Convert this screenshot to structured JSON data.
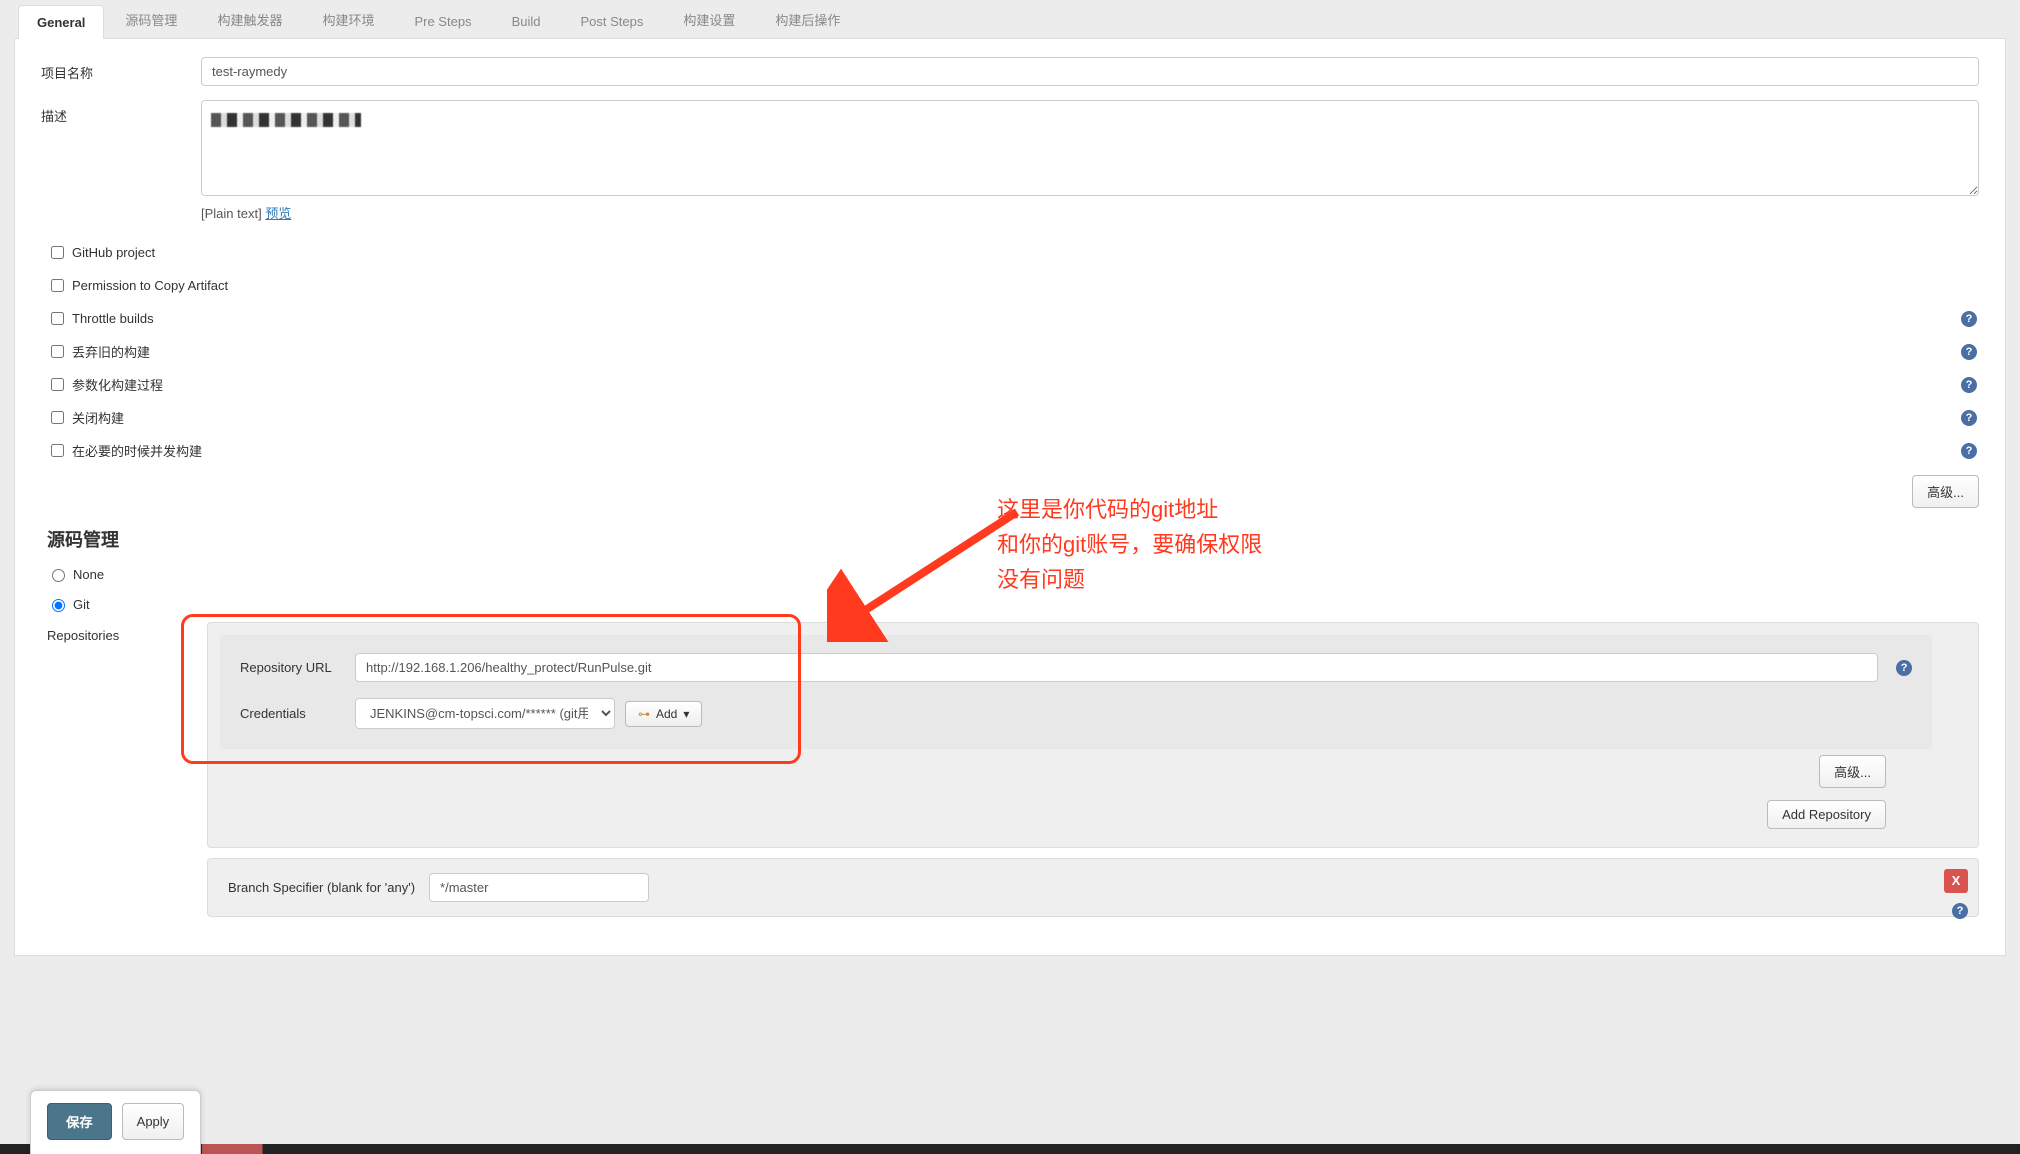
{
  "tabs": {
    "general": "General",
    "scm": "源码管理",
    "triggers": "构建触发器",
    "env": "构建环境",
    "pre": "Pre Steps",
    "build": "Build",
    "post": "Post Steps",
    "settings": "构建设置",
    "postops": "构建后操作"
  },
  "general": {
    "project_name_label": "项目名称",
    "project_name_value": "test-raymedy",
    "description_label": "描述",
    "plain_prefix": "[Plain text] ",
    "preview_link": "预览",
    "checks": {
      "github_project": "GitHub project",
      "permission_copy": "Permission to Copy Artifact",
      "throttle": "Throttle builds",
      "discard_old": "丢弃旧的构建",
      "parameterized": "参数化构建过程",
      "disable": "关闭构建",
      "concurrent": "在必要的时候并发构建"
    },
    "advanced_btn": "高级..."
  },
  "scm_section": {
    "title": "源码管理",
    "opt_none": "None",
    "opt_git": "Git",
    "repositories_label": "Repositories",
    "repo_url_label": "Repository URL",
    "repo_url_value": "http://192.168.1.206/healthy_protect/RunPulse.git",
    "credentials_label": "Credentials",
    "credentials_value": "JENKINS@cm-topsci.com/****** (git用户)",
    "add_btn": "Add",
    "advanced_btn": "高级...",
    "add_repo_btn": "Add Repository",
    "branch_label": "Branch Specifier (blank for 'any')",
    "branch_value": "*/master",
    "close_x": "X"
  },
  "annotation": {
    "line1": "这里是你代码的git地址",
    "line2": "和你的git账号，要确保权限",
    "line3": "没有问题"
  },
  "actions": {
    "save": "保存",
    "apply": "Apply"
  },
  "help_glyph": "?"
}
